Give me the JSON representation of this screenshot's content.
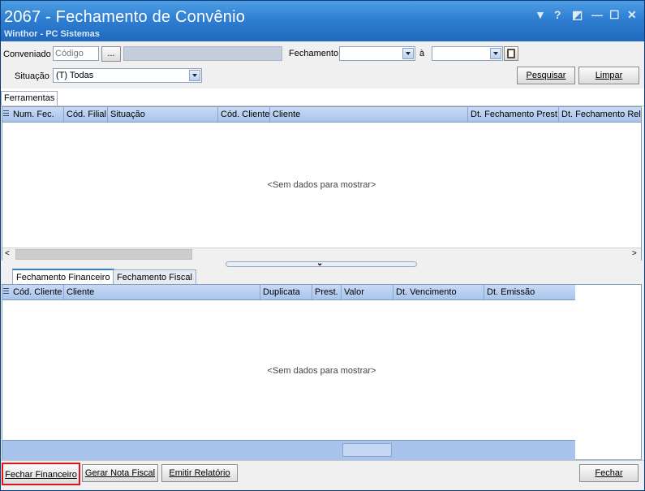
{
  "window": {
    "title": "2067 - Fechamento de Convênio",
    "subtitle": "Winthor - PC Sistemas",
    "controls": {
      "menu": "▼",
      "help": "?",
      "restore": "◩",
      "minimize": "—",
      "maximize": "☐",
      "close": "✕"
    }
  },
  "form": {
    "conveniado_label": "Conveniado",
    "codigo_placeholder": "Código",
    "browse_label": "...",
    "fechamento_label": "Fechamento",
    "ate_label": "à",
    "situacao_label": "Situação",
    "situacao_value": "(T) Todas",
    "pesquisar_label": "Pesquisar",
    "limpar_label": "Limpar"
  },
  "ferramentas_tab": "Ferramentas",
  "grid_top": {
    "columns": [
      "Num. Fec.",
      "Cód. Filial",
      "Situação",
      "Cód. Cliente",
      "Cliente",
      "Dt. Fechamento Prest",
      "Dt. Fechamento Rel."
    ],
    "empty_text": "<Sem dados para mostrar>"
  },
  "tabs": [
    "Fechamento Financeiro",
    "Fechamento Fiscal"
  ],
  "grid_bottom": {
    "columns": [
      "Cód. Cliente",
      "Cliente",
      "Duplicata",
      "Prest.",
      "Valor",
      "Dt. Vencimento",
      "Dt. Emissão"
    ],
    "empty_text": "<Sem dados para mostrar>"
  },
  "footer": {
    "fechar_financeiro": "Fechar Financeiro",
    "gerar_nota_fiscal": "Gerar Nota Fiscal",
    "emitir_relatorio": "Emitir Relatório",
    "fechar": "Fechar"
  },
  "colors": {
    "title_bar": "#2f7fd2",
    "grid_header": "#a8c4ec",
    "highlight_border": "#e0141e"
  }
}
